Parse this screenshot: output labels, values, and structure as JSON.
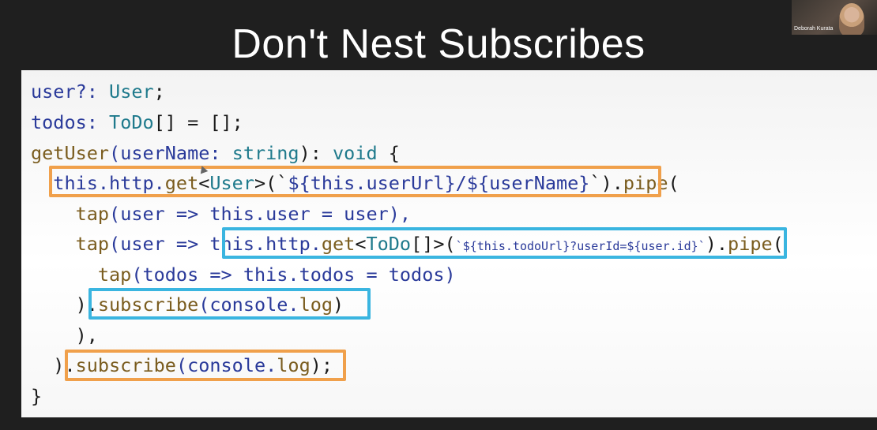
{
  "slide": {
    "title": "Don't Nest Subscribes"
  },
  "video": {
    "presenter_name": "Deborah Kurata"
  },
  "code": {
    "l1": {
      "a": "user?: ",
      "b": "User",
      "c": ";"
    },
    "l2": {
      "a": "todos: ",
      "b": "ToDo",
      "c": "[] = [];"
    },
    "l3": {
      "a": "getUser",
      "b": "(userName: ",
      "c": "string",
      "d": "): ",
      "e": "void",
      "f": " {"
    },
    "l4": {
      "a": "  this",
      "b": ".http.",
      "c": "get",
      "d": "<",
      "e": "User",
      "f": ">(`",
      "g": "${this.userUrl}/${userName}",
      "h": "`)",
      "i": ".",
      "j": "pipe",
      "k": "("
    },
    "l5": {
      "a": "    tap",
      "b": "(user => ",
      "c": "this",
      "d": ".user = user),"
    },
    "l6": {
      "a": "    tap",
      "b": "(user => ",
      "c": "this",
      "d": ".http.",
      "e": "get",
      "f": "<",
      "g": "ToDo",
      "h": "[]>(",
      "i": "`${this.todoUrl}?userId=${user.id}`",
      "j": ").",
      "k": "pipe",
      "l": "("
    },
    "l7": {
      "a": "      tap",
      "b": "(todos => ",
      "c": "this",
      "d": ".todos = todos)"
    },
    "l8": {
      "a": "    ).",
      "b": "subscribe",
      "c": "(console.",
      "d": "log",
      "e": ")"
    },
    "l9": {
      "a": "    ),"
    },
    "l10": {
      "a": "  ).",
      "b": "subscribe",
      "c": "(console.",
      "d": "log",
      "e": ");"
    },
    "l11": {
      "a": "}"
    }
  },
  "colors": {
    "orange_box": "#f0a04b",
    "blue_box": "#3ab5e0"
  }
}
